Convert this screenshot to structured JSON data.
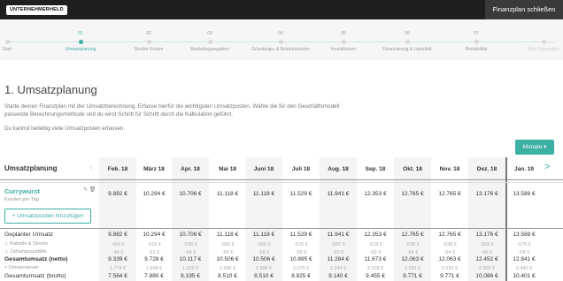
{
  "header": {
    "logo": "UNTERNEHMERHELD",
    "close_label": "Finanzplan schließen"
  },
  "stepper": {
    "steps": [
      {
        "num": "",
        "label": "Start"
      },
      {
        "num": "01",
        "label": "Umsatzplanung",
        "active": true
      },
      {
        "num": "02",
        "label": "Direkte Kosten"
      },
      {
        "num": "03",
        "label": "Marketingausgaben"
      },
      {
        "num": "04",
        "label": "Gründungs- & Betriebskosten"
      },
      {
        "num": "05",
        "label": "Investitionen"
      },
      {
        "num": "06",
        "label": "Finanzierung & Liquidität"
      },
      {
        "num": "07",
        "label": "Rentabilität"
      },
      {
        "num": "",
        "label": "Dein Finanzplan"
      }
    ]
  },
  "page": {
    "title": "1. Umsatzplanung",
    "intro": "Starte deinen Finanzplan mit der Umsatzberechnung. Erfasse hierfür die wichtigsten Umsatzposten. Wähle die für den Geschäftsmodell passende Berechnungsmethode und du wirst Schritt für Schritt durch die Kalkulation geführt.",
    "intro2": "Du kannst beliebig viele Umsatzposten erfassen.",
    "monate_button": "Monate ▾"
  },
  "table": {
    "title": "Umsatzplanung",
    "prev_arrow": "‹",
    "next_arrow": ">",
    "months": [
      "Feb. 18",
      "März 18",
      "Apr. 18",
      "Mai 18",
      "Juni 18",
      "Juli 18",
      "Aug. 18",
      "Sep. 18",
      "Okt. 18",
      "Nov. 18",
      "Dez. 18",
      "Jan. 19"
    ],
    "item": {
      "name": "Currywurst",
      "subtitle": "Kunden pro Tag",
      "values": [
        "9.882 €",
        "10.294 €",
        "10.706 €",
        "11.118 €",
        "11.118 €",
        "11.529 €",
        "11.941 €",
        "12.353 €",
        "12.765 €",
        "12.765 €",
        "13.176 €",
        "13.588 €"
      ]
    },
    "add_button": "+ Umsatzposten hinzufügen",
    "summary": [
      {
        "label": "Geplanter Umsatz",
        "style": "normal",
        "values": [
          "9.882 €",
          "10.294 €",
          "10.706 €",
          "11.118 €",
          "11.118 €",
          "11.529 €",
          "11.941 €",
          "12.353 €",
          "12.765 €",
          "12.765 €",
          "13.176 €",
          "13.588 €"
        ]
      },
      {
        "label": "./. Rabatte & Skonto",
        "style": "small",
        "values": [
          "-494 €",
          "-515 €",
          "-535 €",
          "-556 €",
          "-556 €",
          "-576 €",
          "-597 €",
          "-618 €",
          "-638 €",
          "-638 €",
          "-659 €",
          "-679 €"
        ]
      },
      {
        "label": "./. Zahlungsausfälle",
        "style": "small",
        "values": [
          "-49 €",
          "-51 €",
          "-54 €",
          "-56 €",
          "-56 €",
          "-58 €",
          "-60 €",
          "-62 €",
          "-64 €",
          "-64 €",
          "-66 €",
          "-68 €"
        ]
      },
      {
        "label": "Gesamtumsatz (netto)",
        "style": "bold",
        "values": [
          "9.339 €",
          "9.728 €",
          "10.117 €",
          "10.506 €",
          "10.506 €",
          "10.895 €",
          "11.284 €",
          "11.673 €",
          "12.063 €",
          "12.063 €",
          "12.452 €",
          "12.841 €"
        ]
      },
      {
        "label": "+ Umsatzsteuer",
        "style": "small",
        "values": [
          "1.774 €",
          "1.848 €",
          "1.922 €",
          "1.996 €",
          "1.996 €",
          "2.070 €",
          "2.144 €",
          "2.218 €",
          "2.292 €",
          "2.292 €",
          "2.366 €",
          "2.440 €"
        ]
      },
      {
        "label": "Gesamtumsatz (brutto)",
        "style": "normal",
        "values": [
          "7.564 €",
          "7.880 €",
          "8.195 €",
          "8.510 €",
          "8.510 €",
          "8.825 €",
          "9.140 €",
          "9.455 €",
          "9.771 €",
          "9.771 €",
          "10.086 €",
          "10.401 €"
        ]
      }
    ]
  }
}
